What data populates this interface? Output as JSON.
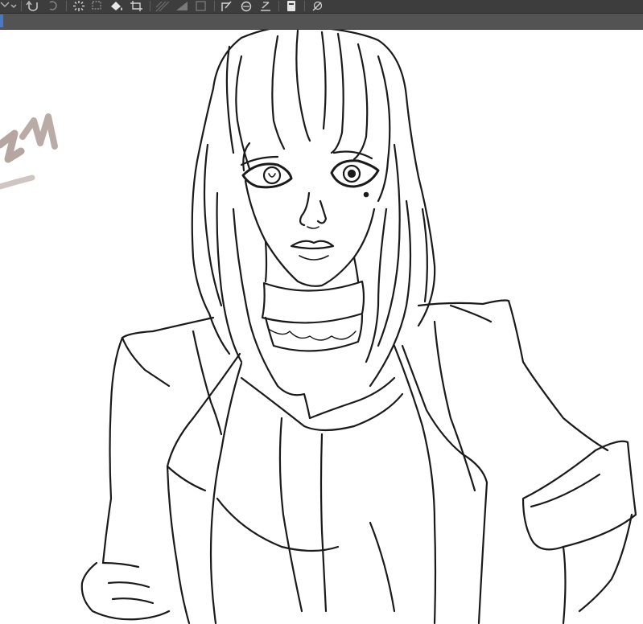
{
  "app": {
    "accent_color": "#4a78c2",
    "toolbar_color": "#3d3d3d",
    "subbar_color": "#535353"
  },
  "toolbar": {
    "icons": [
      "dropdown-icon",
      "undo-icon",
      "redo-icon",
      "loading-spinner-icon",
      "selection-icon",
      "fill-icon",
      "crop-icon",
      "hatch-icon",
      "gradient-icon",
      "frame-icon",
      "transform-icon",
      "rotate-icon",
      "text-icon",
      "clipboard-icon",
      "pen-icon"
    ]
  },
  "canvas": {
    "content": "lineart-figure",
    "stroke_color": "#1a1a1a",
    "brush_stroke_color": "#a89690"
  }
}
